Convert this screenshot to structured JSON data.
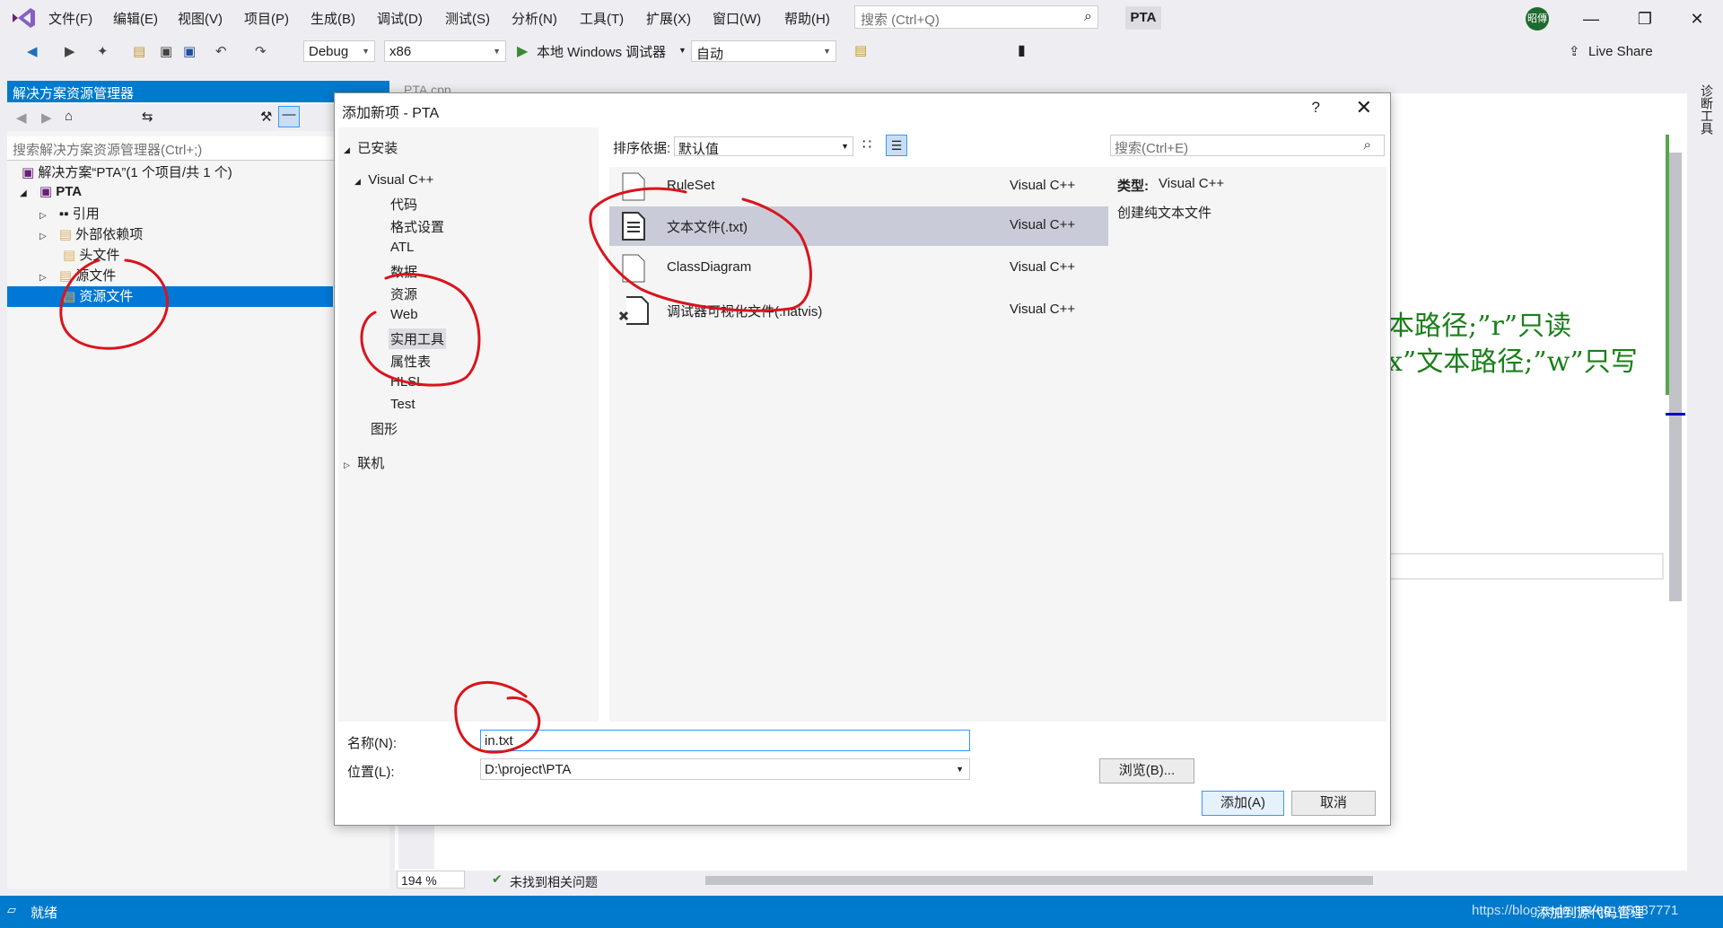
{
  "menubar": {
    "items": [
      "文件(F)",
      "编辑(E)",
      "视图(V)",
      "项目(P)",
      "生成(B)",
      "调试(D)",
      "测试(S)",
      "分析(N)",
      "工具(T)",
      "扩展(X)",
      "窗口(W)",
      "帮助(H)"
    ],
    "search_placeholder": "搜索 (Ctrl+Q)",
    "project_badge": "PTA",
    "avatar_text": "昭傳"
  },
  "toolbar": {
    "config": "Debug",
    "platform": "x86",
    "run_label": "本地 Windows 调试器",
    "mode": "自动",
    "live_share": "Live Share"
  },
  "solution_explorer": {
    "title": "解决方案资源管理器",
    "search_placeholder": "搜索解决方案资源管理器(Ctrl+;)",
    "tree": [
      {
        "label": "解决方案“PTA”(1 个项目/共 1 个)"
      },
      {
        "label": "PTA"
      },
      {
        "label": "引用"
      },
      {
        "label": "外部依赖项"
      },
      {
        "label": "头文件"
      },
      {
        "label": "源文件"
      },
      {
        "label": "资源文件"
      }
    ]
  },
  "editor": {
    "tab": "PTA.cpp",
    "code_line1": "本路径;”r”只读",
    "code_line2": "x”文本路径;”w”只写",
    "zoom": "194 %",
    "issues": "未找到相关问题",
    "diag_tab": "诊断工具"
  },
  "dialog": {
    "title": "添加新项 - PTA",
    "help": "?",
    "installed": "已安装",
    "categories": {
      "visual_cpp": "Visual C++",
      "items": [
        "代码",
        "格式设置",
        "ATL",
        "数据",
        "资源",
        "Web",
        "实用工具",
        "属性表",
        "HLSL",
        "Test"
      ],
      "graphics": "图形",
      "online": "联机"
    },
    "sort_label": "排序依据:",
    "sort_value": "默认值",
    "search_placeholder": "搜索(Ctrl+E)",
    "templates": [
      {
        "name": "RuleSet",
        "lang": "Visual C++"
      },
      {
        "name": "文本文件(.txt)",
        "lang": "Visual C++"
      },
      {
        "name": "ClassDiagram",
        "lang": "Visual C++"
      },
      {
        "name": "调试器可视化文件(.natvis)",
        "lang": "Visual C++"
      }
    ],
    "detail_type_label": "类型:",
    "detail_type_value": "Visual C++",
    "detail_desc": "创建纯文本文件",
    "name_label": "名称(N):",
    "name_value": "in.txt",
    "location_label": "位置(L):",
    "location_value": "D:\\project\\PTA",
    "browse": "浏览(B)...",
    "add": "添加(A)",
    "cancel": "取消"
  },
  "statusbar": {
    "ready": "就绪",
    "right_text": "https://blog.csdn.net/qq_45337771",
    "source_control": "添加到源代码管理"
  },
  "colors": {
    "accent": "#007acc",
    "annotation": "#d9141c",
    "selected_row": "#c9cbd8"
  }
}
